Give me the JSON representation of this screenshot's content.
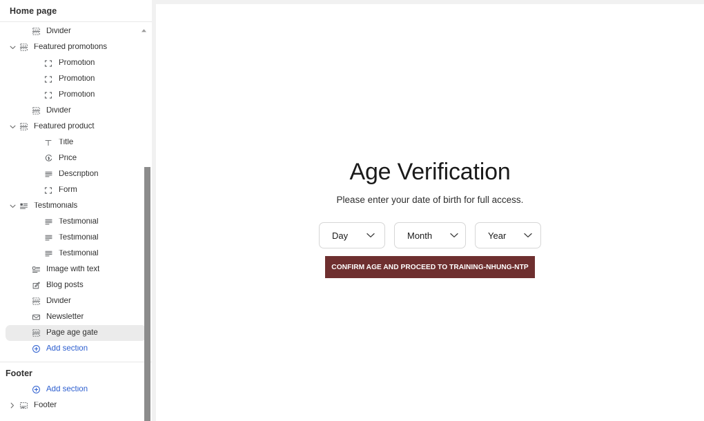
{
  "sidebar": {
    "header_title": "Home page",
    "scroll_up_icon": "caret-up-icon",
    "items": [
      {
        "label": "Divider",
        "icon": "divider-icon",
        "level": 1,
        "caret": "none",
        "selected": false
      },
      {
        "label": "Featured promotions",
        "icon": "divider-icon",
        "level": 0,
        "caret": "expanded",
        "selected": false
      },
      {
        "label": "Promotion",
        "icon": "block-icon",
        "level": 2,
        "caret": "none",
        "selected": false
      },
      {
        "label": "Promotion",
        "icon": "block-icon",
        "level": 2,
        "caret": "none",
        "selected": false
      },
      {
        "label": "Promotion",
        "icon": "block-icon",
        "level": 2,
        "caret": "none",
        "selected": false
      },
      {
        "label": "Divider",
        "icon": "divider-icon",
        "level": 1,
        "caret": "none",
        "selected": false
      },
      {
        "label": "Featured product",
        "icon": "divider-icon",
        "level": 0,
        "caret": "expanded",
        "selected": false
      },
      {
        "label": "Title",
        "icon": "text-icon",
        "level": 2,
        "caret": "none",
        "selected": false
      },
      {
        "label": "Price",
        "icon": "price-icon",
        "level": 2,
        "caret": "none",
        "selected": false
      },
      {
        "label": "Description",
        "icon": "paragraph-icon",
        "level": 2,
        "caret": "none",
        "selected": false
      },
      {
        "label": "Form",
        "icon": "block-icon",
        "level": 2,
        "caret": "none",
        "selected": false
      },
      {
        "label": "Testimonials",
        "icon": "testimonials-icon",
        "level": 0,
        "caret": "expanded",
        "selected": false
      },
      {
        "label": "Testimonial",
        "icon": "paragraph-icon",
        "level": 2,
        "caret": "none",
        "selected": false
      },
      {
        "label": "Testimonial",
        "icon": "paragraph-icon",
        "level": 2,
        "caret": "none",
        "selected": false
      },
      {
        "label": "Testimonial",
        "icon": "paragraph-icon",
        "level": 2,
        "caret": "none",
        "selected": false
      },
      {
        "label": "Image with text",
        "icon": "image-with-text-icon",
        "level": 1,
        "caret": "none",
        "selected": false
      },
      {
        "label": "Blog posts",
        "icon": "blog-icon",
        "level": 1,
        "caret": "none",
        "selected": false
      },
      {
        "label": "Divider",
        "icon": "divider-icon",
        "level": 1,
        "caret": "none",
        "selected": false
      },
      {
        "label": "Newsletter",
        "icon": "envelope-icon",
        "level": 1,
        "caret": "none",
        "selected": false
      },
      {
        "label": "Page age gate",
        "icon": "divider-icon",
        "level": 1,
        "caret": "none",
        "selected": true
      },
      {
        "label": "Add section",
        "icon": "circle-plus-icon",
        "level": 1,
        "caret": "none",
        "selected": false,
        "action": true
      }
    ],
    "footer_group": {
      "title": "Footer",
      "items": [
        {
          "label": "Add section",
          "icon": "circle-plus-icon",
          "level": 1,
          "caret": "none",
          "selected": false,
          "action": true
        },
        {
          "label": "Footer",
          "icon": "footer-icon",
          "level": 0,
          "caret": "collapsed",
          "selected": false
        }
      ]
    }
  },
  "preview": {
    "age_gate": {
      "title": "Age Verification",
      "subtitle": "Please enter your date of birth for full access.",
      "selects": [
        {
          "name": "day",
          "value": "Day",
          "chevron": "chevron-down-icon"
        },
        {
          "name": "month",
          "value": "Month",
          "chevron": "chevron-down-icon"
        },
        {
          "name": "year",
          "value": "Year",
          "chevron": "chevron-down-icon"
        }
      ],
      "confirm_label": "CONFIRM AGE AND PROCEED TO TRAINING-NHUNG-NTP",
      "confirm_color": "#6e2f2f"
    }
  }
}
